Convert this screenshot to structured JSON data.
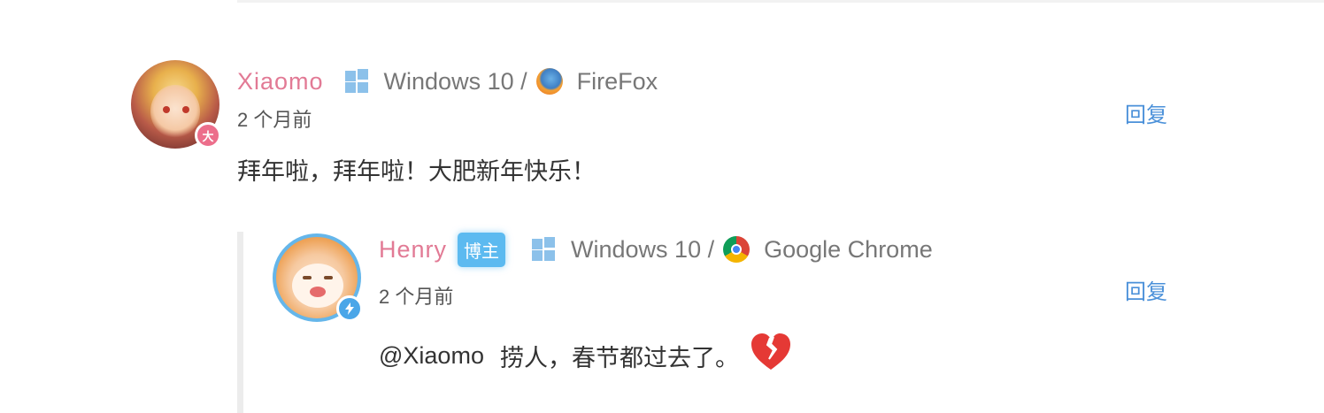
{
  "comments": [
    {
      "author": "Xiaomo",
      "level_badge": "大",
      "os": "Windows 10 /",
      "browser": "FireFox",
      "time": "2 个月前",
      "reply_label": "回复",
      "text": "拜年啦，拜年啦！大肥新年快乐！"
    }
  ],
  "replies": [
    {
      "author": "Henry",
      "role_tag": "博主",
      "os": "Windows 10 /",
      "browser": "Google Chrome",
      "time": "2 个月前",
      "reply_label": "回复",
      "mention": "@Xiaomo",
      "text": "捞人，春节都过去了。",
      "emoji": "broken-heart-icon"
    }
  ],
  "colors": {
    "author": "#e27a95",
    "link": "#4a90d9",
    "role_tag_bg": "#5cbaf0",
    "reply_bar": "#ececec"
  }
}
